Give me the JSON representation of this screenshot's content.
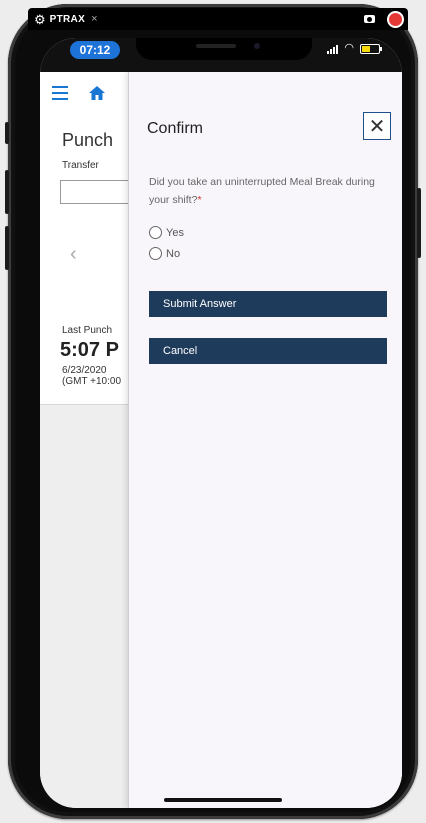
{
  "recorder": {
    "app_name": "PTRAX",
    "close_symbol": "×"
  },
  "status_bar": {
    "time": "07:12"
  },
  "background_page": {
    "title": "Punch",
    "transfer_label": "Transfer",
    "prev_symbol": "‹",
    "last_punch_label": "Last Punch",
    "last_punch_time": "5:07 P",
    "last_punch_date": "6/23/2020",
    "last_punch_tz": "(GMT +10:00"
  },
  "dialog": {
    "title": "Confirm",
    "close_symbol": "✕",
    "question": "Did you take an uninterrupted Meal Break during your shift?",
    "required_marker": "*",
    "options": [
      {
        "label": "Yes",
        "selected": false
      },
      {
        "label": "No",
        "selected": false
      }
    ],
    "submit_label": "Submit Answer",
    "cancel_label": "Cancel"
  },
  "colors": {
    "accent_blue": "#1976d2",
    "button_navy": "#1f3b5c",
    "time_pill": "#1e73d8",
    "required_red": "#d32f2f",
    "recording_red": "#e53935"
  },
  "icons": [
    "gear-icon",
    "camera-icon",
    "record-icon",
    "signal-icon",
    "wifi-icon",
    "battery-icon",
    "hamburger-menu-icon",
    "home-icon",
    "chevron-left-icon",
    "close-icon"
  ]
}
